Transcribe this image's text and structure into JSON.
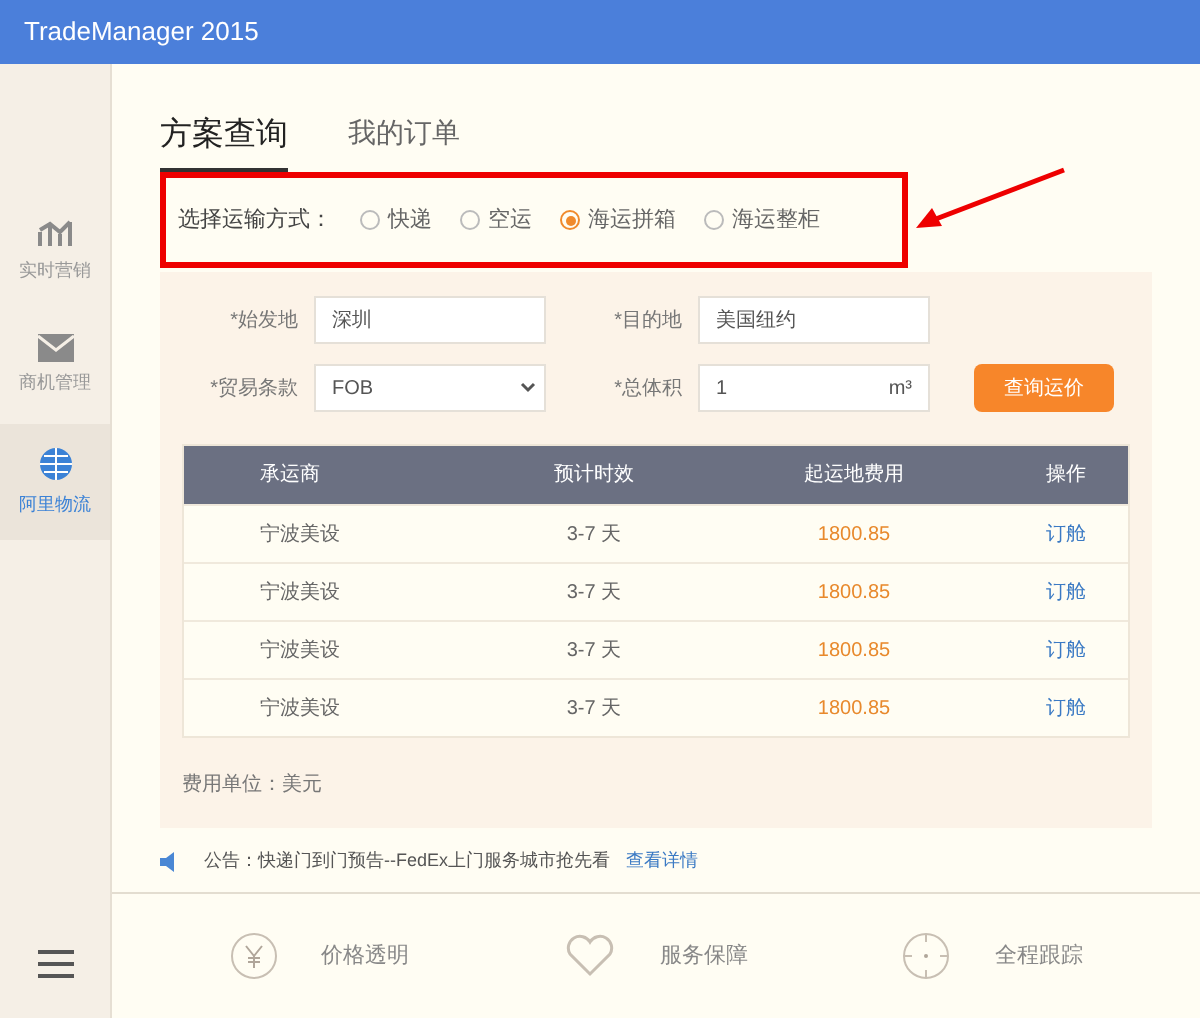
{
  "window": {
    "title": "TradeManager 2015"
  },
  "sidebar": {
    "items": [
      {
        "label": "实时营销",
        "kind": "chart",
        "selected": false
      },
      {
        "label": "商机管理",
        "kind": "mail",
        "selected": false
      },
      {
        "label": "阿里物流",
        "kind": "globe",
        "selected": true
      }
    ]
  },
  "tabs": [
    {
      "label": "方案查询",
      "selected": true
    },
    {
      "label": "我的订单",
      "selected": false
    }
  ],
  "shipping": {
    "label": "选择运输方式：",
    "options": [
      {
        "label": "快递",
        "selected": false
      },
      {
        "label": "空运",
        "selected": false
      },
      {
        "label": "海运拼箱",
        "selected": true
      },
      {
        "label": "海运整柜",
        "selected": false
      }
    ]
  },
  "form": {
    "origin": {
      "label": "*始发地",
      "value": "深圳"
    },
    "destination": {
      "label": "*目的地",
      "value": "美国纽约"
    },
    "terms": {
      "label": "*贸易条款",
      "value": "FOB"
    },
    "volume": {
      "label": "*总体积",
      "value": "1",
      "unit": "m³"
    },
    "submit": "查询运价"
  },
  "table": {
    "columns": [
      "承运商",
      "预计时效",
      "起运地费用",
      "操作"
    ],
    "rows": [
      [
        "宁波美设",
        "3-7 天",
        "1800.85",
        "订舱"
      ],
      [
        "宁波美设",
        "3-7 天",
        "1800.85",
        "订舱"
      ],
      [
        "宁波美设",
        "3-7 天",
        "1800.85",
        "订舱"
      ],
      [
        "宁波美设",
        "3-7 天",
        "1800.85",
        "订舱"
      ]
    ]
  },
  "currency_note": "费用单位：美元",
  "notice": {
    "text": "公告：快递门到门预告--FedEx上门服务城市抢先看",
    "link": "查看详情"
  },
  "features": [
    {
      "label": "价格透明",
      "kind": "yen"
    },
    {
      "label": "服务保障",
      "kind": "heart"
    },
    {
      "label": "全程跟踪",
      "kind": "target"
    }
  ]
}
